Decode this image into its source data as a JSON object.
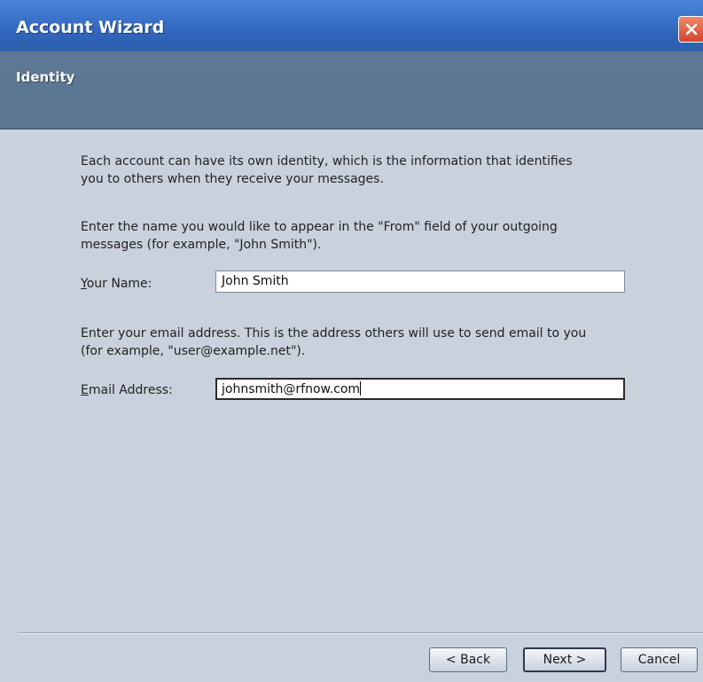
{
  "window": {
    "title": "Account Wizard"
  },
  "header": {
    "title": "Identity"
  },
  "content": {
    "intro_line1": "Each account can have its own identity, which is the information that identifies",
    "intro_line2": "you to others when they receive your messages.",
    "name_instruction_line1": "Enter the name you would like to appear in the \"From\" field of your outgoing",
    "name_instruction_line2": "messages (for example, \"John Smith\").",
    "name_label_mnemonic": "Y",
    "name_label_rest": "our Name:",
    "name_value": "John Smith",
    "email_instruction_line1": "Enter your email address. This is the address others will use to send email to you",
    "email_instruction_line2": "(for example, \"user@example.net\").",
    "email_label_mnemonic": "E",
    "email_label_rest": "mail Address:",
    "email_value": "johnsmith@rfnow.com"
  },
  "buttons": {
    "back": "< Back",
    "next": "Next >",
    "cancel": "Cancel"
  },
  "colors": {
    "titlebar": "#3a73c9",
    "header": "#5d7893",
    "body": "#c9d1dc",
    "close": "#d2452a"
  },
  "icons": {
    "close": "close-x-icon"
  }
}
